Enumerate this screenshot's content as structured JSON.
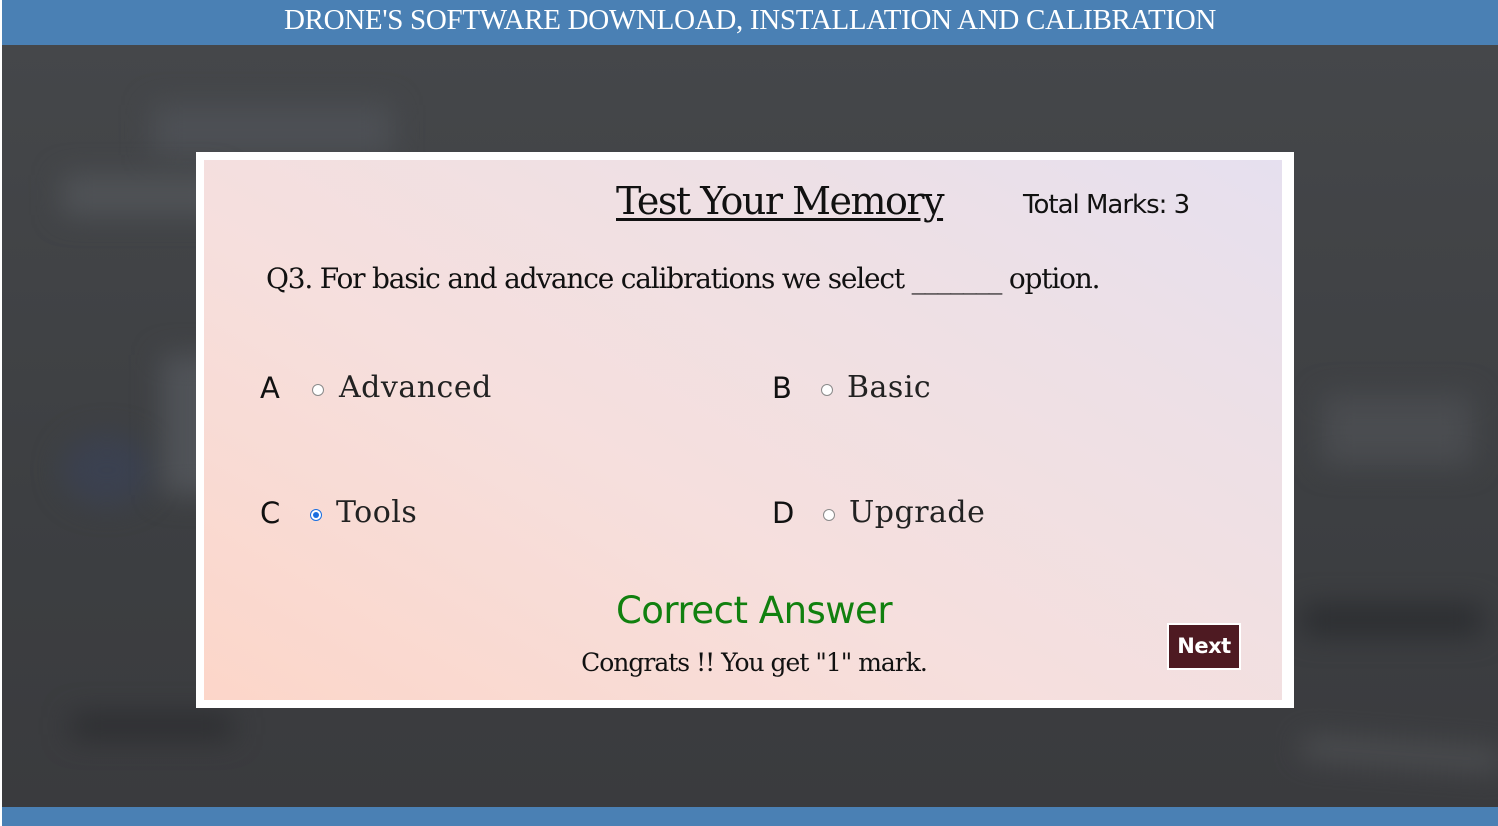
{
  "header": {
    "title": "DRONE'S SOFTWARE DOWNLOAD, INSTALLATION AND CALIBRATION"
  },
  "quiz": {
    "title": "Test Your Memory",
    "total_marks": "Total Marks: 3",
    "question": "Q3. For basic and advance calibrations we select _______ option.",
    "options": [
      {
        "letter": "A",
        "label": "Advanced",
        "selected": false
      },
      {
        "letter": "B",
        "label": "Basic",
        "selected": false
      },
      {
        "letter": "C",
        "label": "Tools",
        "selected": true
      },
      {
        "letter": "D",
        "label": "Upgrade",
        "selected": false
      }
    ],
    "result": "Correct Answer",
    "result_color": "#11800f",
    "message": "Congrats !! You get \"1\" mark.",
    "next_label": "Next"
  },
  "colors": {
    "header_bar": "#4a80b4",
    "next_button": "#4e1a22",
    "radio_checked": "#1a6fe0"
  }
}
